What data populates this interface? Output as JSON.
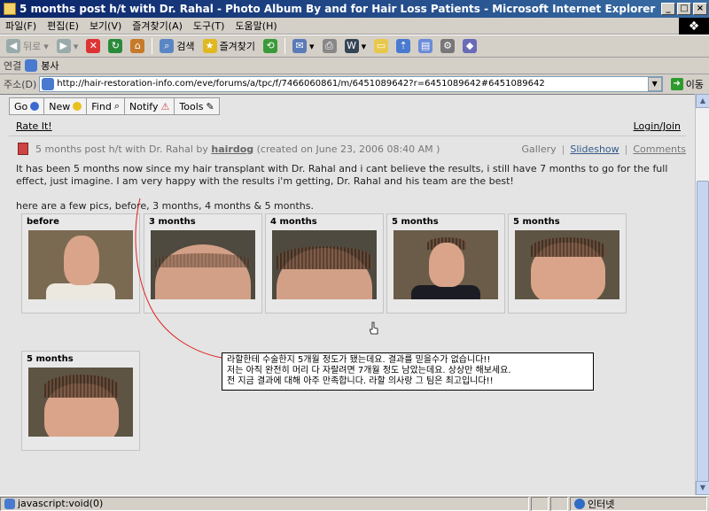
{
  "window": {
    "title": "5 months post h/t with Dr. Rahal - Photo Album By and for Hair Loss Patients - Microsoft Internet Explorer",
    "min": "_",
    "max": "□",
    "close": "×"
  },
  "menu": [
    "파일(F)",
    "편집(E)",
    "보기(V)",
    "즐겨찾기(A)",
    "도구(T)",
    "도움말(H)"
  ],
  "toolbar": {
    "back": "뒤로",
    "search": "검색",
    "favorites": "즐겨찾기"
  },
  "links": {
    "label": "연결",
    "item": "봉사"
  },
  "address": {
    "label": "주소(D)",
    "url": "http://hair-restoration-info.com/eve/forums/a/tpc/f/7466060861/m/6451089642?r=6451089642#6451089642",
    "go": "이동"
  },
  "forum_nav": [
    "Go",
    "New",
    "Find",
    "Notify",
    "Tools"
  ],
  "rate": "Rate It!",
  "login": "Login/Join",
  "post": {
    "title_pre": "5 months post h/t with Dr. Rahal by ",
    "author": "hairdog",
    "date": "(created on June 23, 2006 08:40 AM )",
    "gallery": "Gallery",
    "slideshow": "Slideshow",
    "comments": "Comments",
    "body1": "It has been 5 months now since my hair transplant with Dr. Rahal and i cant believe the results, i still have 7 months to go for the full effect, just imagine. I am very happy with the results i'm getting, Dr. Rahal and his team are the best!",
    "body2": "here are a few pics, before, 3 months, 4 months & 5 months."
  },
  "photos": [
    "before",
    "3 months",
    "4 months",
    "5 months",
    "5 months",
    "5 months"
  ],
  "korean_note": [
    "라할한테 수술한지 5개월 정도가 됐는데요. 결과를 믿을수가 없습니다!!",
    "저는 아직 완전히 머리 다 자랄려면 7개월 정도 남았는데요. 상상만 해보세요.",
    "전 지금 결과에 대해 아주 만족합니다. 라할 의사랑 그 팀은 최고입니다!!"
  ],
  "status": {
    "text": "javascript:void(0)",
    "zone": "인터넷"
  }
}
